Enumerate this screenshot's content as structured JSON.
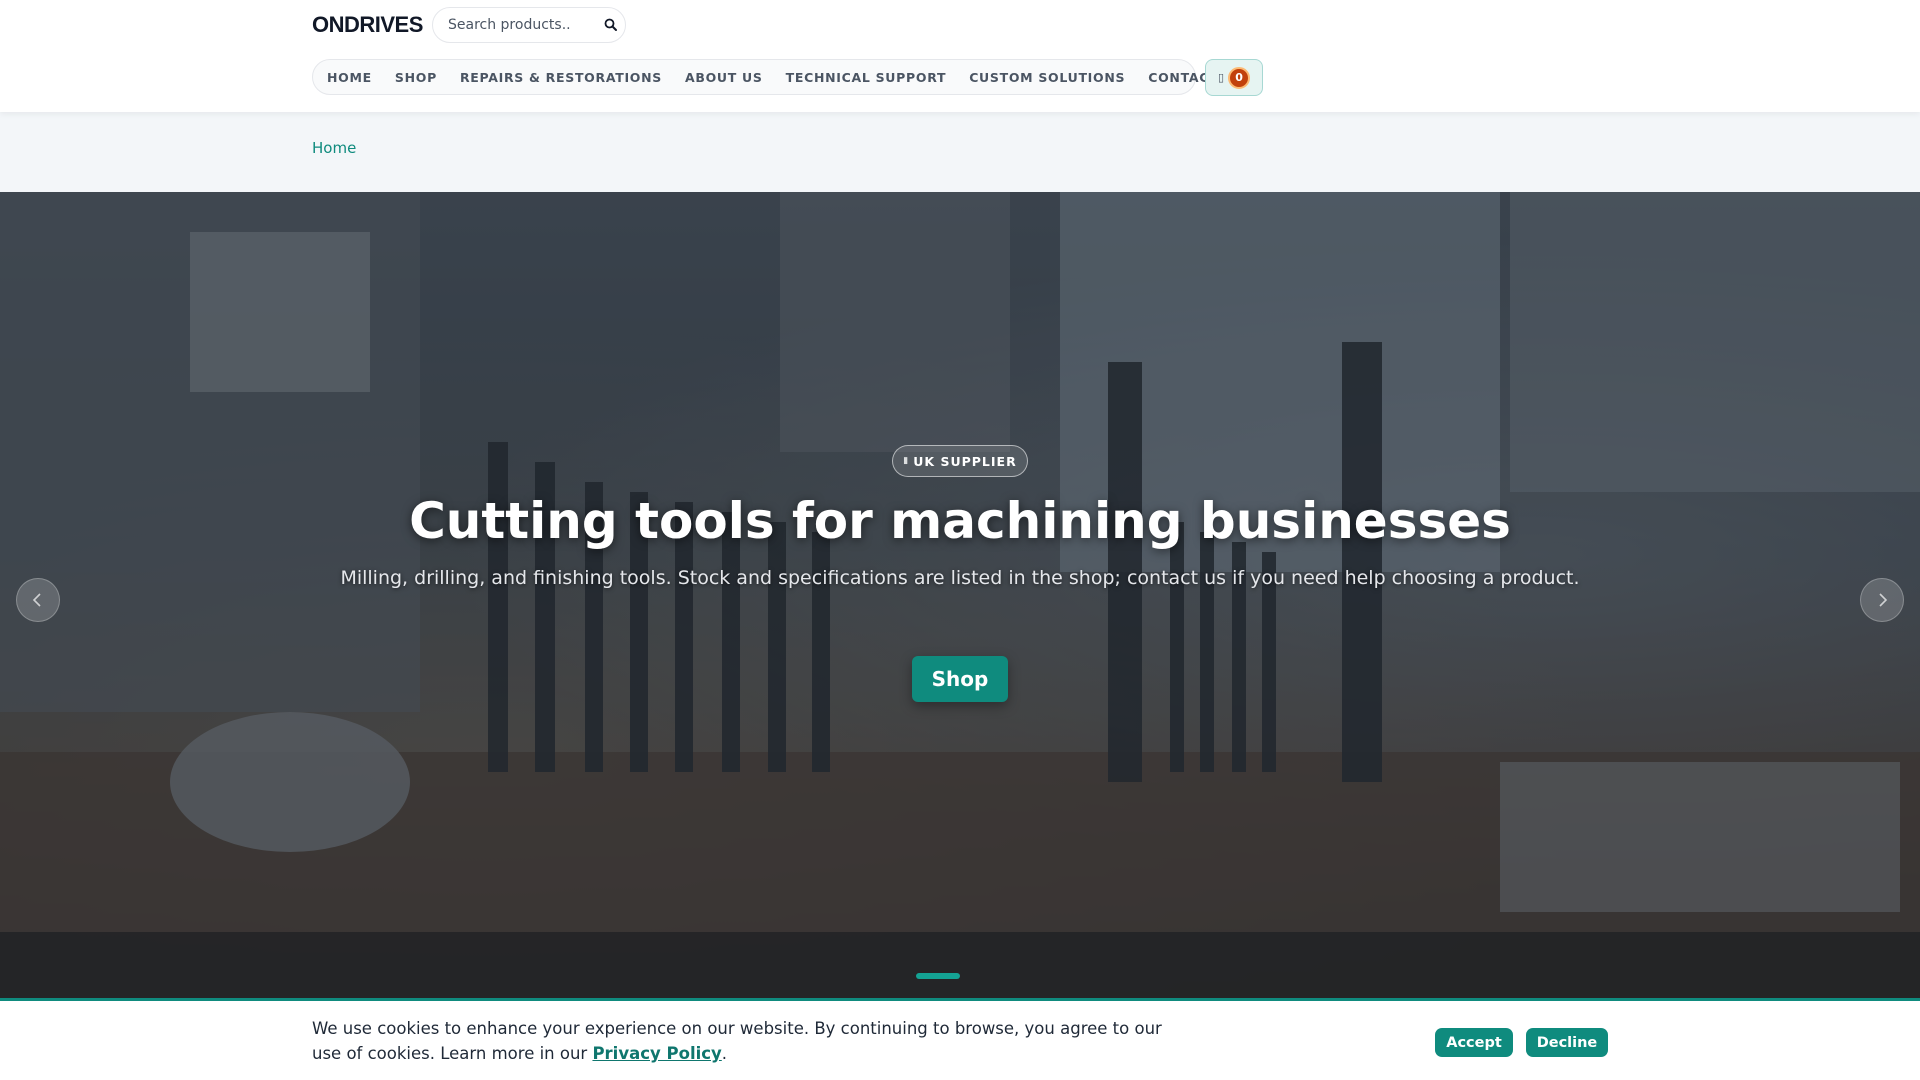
{
  "header": {
    "logo": "ONDRIVES",
    "search": {
      "placeholder": "Search products..",
      "value": ""
    },
    "nav": [
      {
        "label": "HOME"
      },
      {
        "label": "SHOP"
      },
      {
        "label": "REPAIRS & RESTORATIONS"
      },
      {
        "label": "ABOUT US"
      },
      {
        "label": "TECHNICAL SUPPORT"
      },
      {
        "label": "CUSTOM SOLUTIONS"
      },
      {
        "label": "CONTACT"
      }
    ],
    "cart": {
      "icon": "cart-icon",
      "count": "0"
    }
  },
  "breadcrumb": {
    "home": "Home"
  },
  "hero": {
    "badge": "UK SUPPLIER",
    "title": "Cutting tools for machining businesses",
    "subtitle": "Milling, drilling, and finishing tools. Stock and specifications are listed in the shop; contact us if you need help choosing a product.",
    "button": "Shop",
    "slide_current": 1,
    "slide_count": 1
  },
  "cookie": {
    "text": "We use cookies to enhance your experience on our website. By continuing to browse, you agree to our use of cookies. Learn more in our ",
    "link": "Privacy Policy",
    "suffix": ".",
    "accept": "Accept",
    "decline": "Decline"
  },
  "colors": {
    "accent": "#0f8b7e",
    "badge": "#c2410c",
    "breadcrumb_bg": "#f3f6f9"
  }
}
